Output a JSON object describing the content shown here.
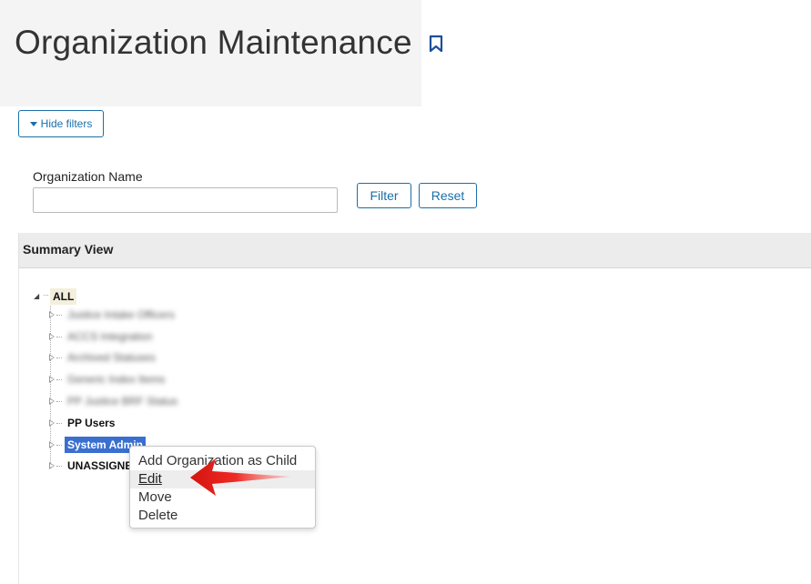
{
  "page": {
    "title": "Organization Maintenance"
  },
  "filters": {
    "toggle_label": "Hide filters",
    "org_name_label": "Organization Name",
    "org_name_value": "",
    "org_name_placeholder": "",
    "filter_label": "Filter",
    "reset_label": "Reset"
  },
  "summary": {
    "header": "Summary View",
    "tree": {
      "root": "ALL",
      "children": [
        {
          "label": "Justice Intake Officers",
          "blurred": true
        },
        {
          "label": "ACCS Integration",
          "blurred": true
        },
        {
          "label": "Archived Statuses",
          "blurred": true
        },
        {
          "label": "Generic Index Items",
          "blurred": true
        },
        {
          "label": "PP Justice BRF Status",
          "blurred": true
        },
        {
          "label": "PP Users",
          "blurred": false
        },
        {
          "label": "System Admin",
          "blurred": false,
          "selected": true
        },
        {
          "label": "UNASSIGNED",
          "blurred": false
        }
      ]
    }
  },
  "context_menu": {
    "items": [
      "Add Organization as Child",
      "Edit",
      "Move",
      "Delete"
    ],
    "hovered": "Edit"
  },
  "colors": {
    "accent": "#1b6fa8",
    "selection": "#3a6fd0",
    "arrow": "#e8231f"
  },
  "icons": {
    "bookmark": "bookmark-icon",
    "caret": "caret-down-icon",
    "arrow": "red-pointer-arrow-icon"
  }
}
